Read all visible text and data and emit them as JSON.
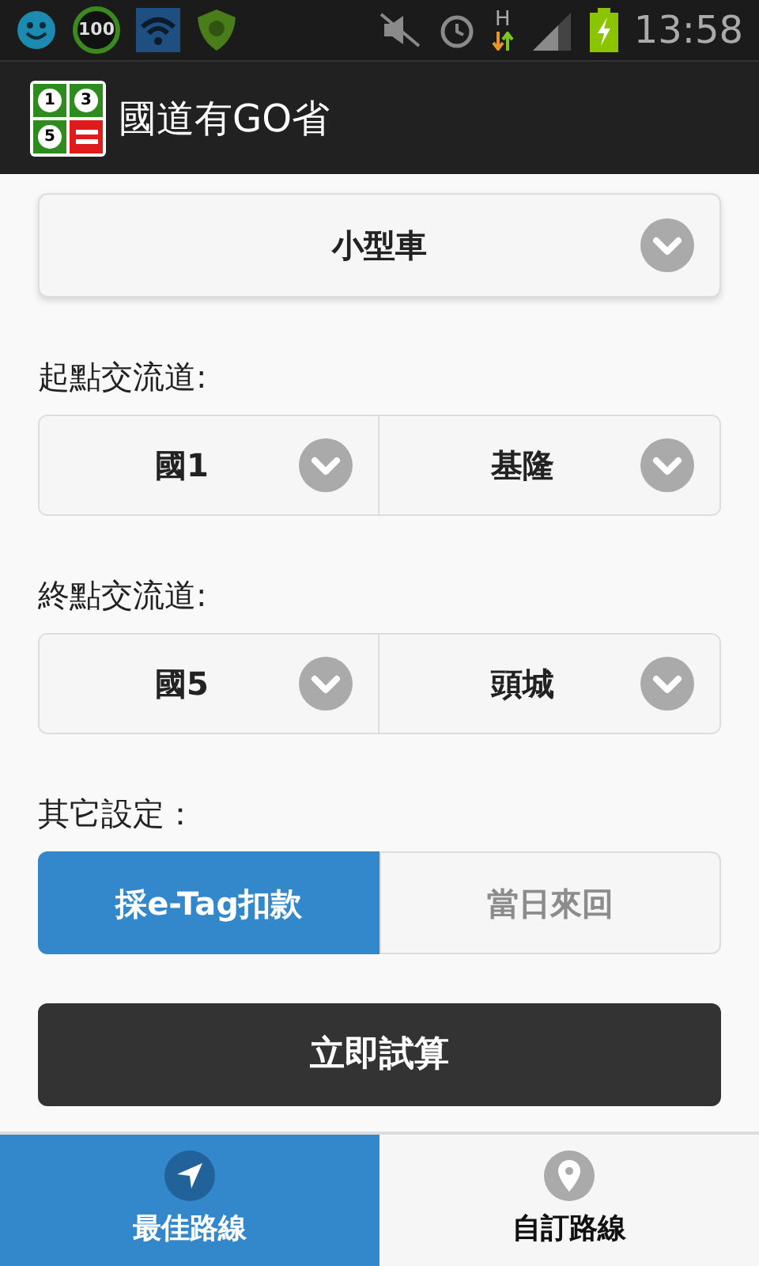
{
  "status_bar": {
    "battery_badge": "100",
    "network_type": "H",
    "time": "13:58"
  },
  "app_bar": {
    "logo_marks": [
      "1",
      "3",
      "5"
    ],
    "title": "國道有GO省"
  },
  "vehicle_select": {
    "value": "小型車"
  },
  "start": {
    "label": "起點交流道:",
    "highway": "國1",
    "interchange": "基隆"
  },
  "end": {
    "label": "終點交流道:",
    "highway": "國5",
    "interchange": "頭城"
  },
  "options": {
    "label": "其它設定：",
    "toggles": [
      {
        "label": "採e-Tag扣款",
        "selected": true
      },
      {
        "label": "當日來回",
        "selected": false
      }
    ]
  },
  "submit": {
    "label": "立即試算"
  },
  "nav": [
    {
      "label": "最佳路線",
      "kind": "arrow",
      "selected": true
    },
    {
      "label": "自訂路線",
      "kind": "pin",
      "selected": false
    }
  ]
}
